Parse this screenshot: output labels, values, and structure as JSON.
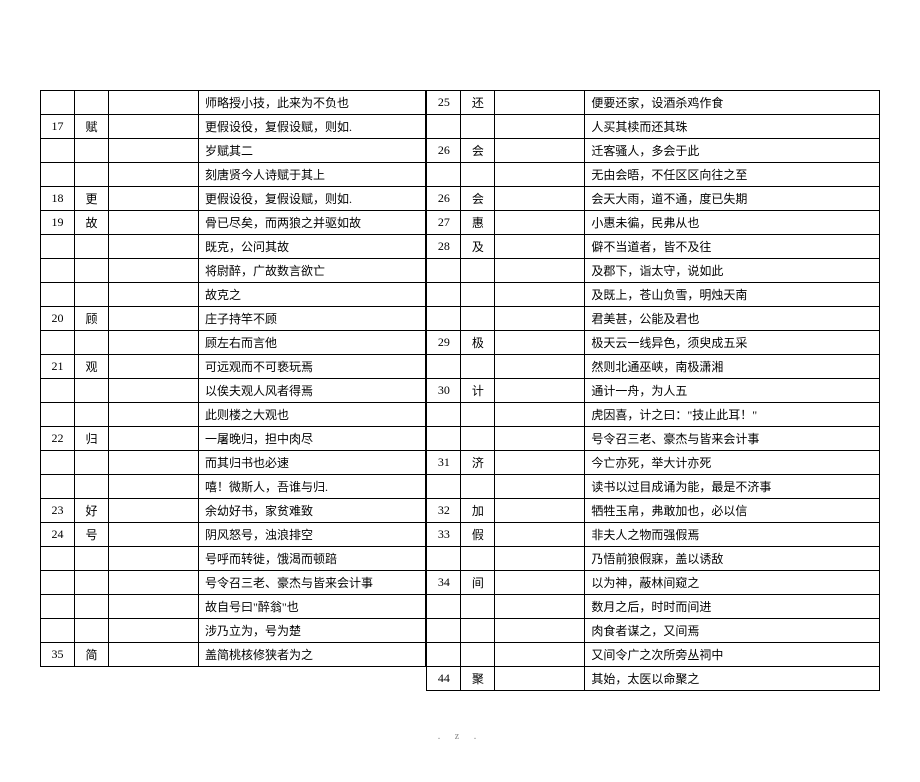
{
  "header_mark": "-",
  "footer_mark": ". z .",
  "left_rows": [
    {
      "num": "",
      "char": "",
      "example": "师略授小技，此来为不负也"
    },
    {
      "num": "17",
      "char": "赋",
      "example": "更假设役，复假设赋，则如."
    },
    {
      "num": "",
      "char": "",
      "example": "岁赋其二"
    },
    {
      "num": "",
      "char": "",
      "example": "刻唐贤今人诗赋于其上"
    },
    {
      "num": "18",
      "char": "更",
      "example": "更假设役，复假设赋，则如."
    },
    {
      "num": "19",
      "char": "故",
      "example": "骨已尽矣，而两狼之并驱如故"
    },
    {
      "num": "",
      "char": "",
      "example": "既克，公问其故"
    },
    {
      "num": "",
      "char": "",
      "example": "将尉醉，广故数言欲亡"
    },
    {
      "num": "",
      "char": "",
      "example": "故克之"
    },
    {
      "num": "20",
      "char": "顾",
      "example": "庄子持竿不顾"
    },
    {
      "num": "",
      "char": "",
      "example": "顾左右而言他"
    },
    {
      "num": "21",
      "char": "观",
      "example": "可远观而不可亵玩焉"
    },
    {
      "num": "",
      "char": "",
      "example": "以俟夫观人风者得焉"
    },
    {
      "num": "",
      "char": "",
      "example": "此则楼之大观也"
    },
    {
      "num": "22",
      "char": "归",
      "example": "一屠晚归，担中肉尽"
    },
    {
      "num": "",
      "char": "",
      "example": "而其归书也必速"
    },
    {
      "num": "",
      "char": "",
      "example": "嘻！微斯人，吾谁与归."
    },
    {
      "num": "23",
      "char": "好",
      "example": "余幼好书，家贫难致"
    },
    {
      "num": "24",
      "char": "号",
      "example": "阴风怒号，浊浪排空"
    },
    {
      "num": "",
      "char": "",
      "example": "号呼而转徙，饿渴而顿踣"
    },
    {
      "num": "",
      "char": "",
      "example": "号令召三老、豪杰与皆来会计事"
    },
    {
      "num": "",
      "char": "",
      "example": "故自号曰\"醉翁\"也"
    },
    {
      "num": "",
      "char": "",
      "example": "涉乃立为，号为楚"
    },
    {
      "num": "35",
      "char": "简",
      "example": "盖简桃核修狭者为之"
    }
  ],
  "right_rows": [
    {
      "num": "25",
      "char": "还",
      "example": "便要还家，设酒杀鸡作食"
    },
    {
      "num": "",
      "char": "",
      "example": "人买其椟而还其珠"
    },
    {
      "num": "26",
      "char": "会",
      "example": "迁客骚人，多会于此"
    },
    {
      "num": "",
      "char": "",
      "example": "无由会晤，不任区区向往之至"
    },
    {
      "num": "26",
      "char": "会",
      "example": "会天大雨，道不通，度已失期"
    },
    {
      "num": "27",
      "char": "惠",
      "example": "小惠未徧，民弗从也"
    },
    {
      "num": "28",
      "char": "及",
      "example": "僻不当道者，皆不及往"
    },
    {
      "num": "",
      "char": "",
      "example": "及郡下，诣太守，说如此"
    },
    {
      "num": "",
      "char": "",
      "example": "及既上，苍山负雪，明烛天南"
    },
    {
      "num": "",
      "char": "",
      "example": "君美甚，公能及君也"
    },
    {
      "num": "29",
      "char": "极",
      "example": "极天云一线异色，须臾成五采"
    },
    {
      "num": "",
      "char": "",
      "example": "然则北通巫峡，南极潇湘"
    },
    {
      "num": "30",
      "char": "计",
      "example": "通计一舟，为人五"
    },
    {
      "num": "",
      "char": "",
      "example": "虎因喜，计之曰：\"技止此耳！\""
    },
    {
      "num": "",
      "char": "",
      "example": "号令召三老、豪杰与皆来会计事"
    },
    {
      "num": "31",
      "char": "济",
      "example": "今亡亦死，举大计亦死"
    },
    {
      "num": "",
      "char": "",
      "example": "读书以过目成诵为能，最是不济事"
    },
    {
      "num": "32",
      "char": "加",
      "example": "牺牲玉帛，弗敢加也，必以信"
    },
    {
      "num": "33",
      "char": "假",
      "example": "非夫人之物而强假焉"
    },
    {
      "num": "",
      "char": "",
      "example": "乃悟前狼假寐，盖以诱敌"
    },
    {
      "num": "34",
      "char": "间",
      "example": "以为神，蔽林间窥之"
    },
    {
      "num": "",
      "char": "",
      "example": "数月之后，时时而间进"
    },
    {
      "num": "",
      "char": "",
      "example": "肉食者谋之，又间焉"
    },
    {
      "num": "",
      "char": "",
      "example": "又间令广之次所旁丛祠中"
    },
    {
      "num": "44",
      "char": "聚",
      "example": "其始，太医以命聚之"
    }
  ]
}
